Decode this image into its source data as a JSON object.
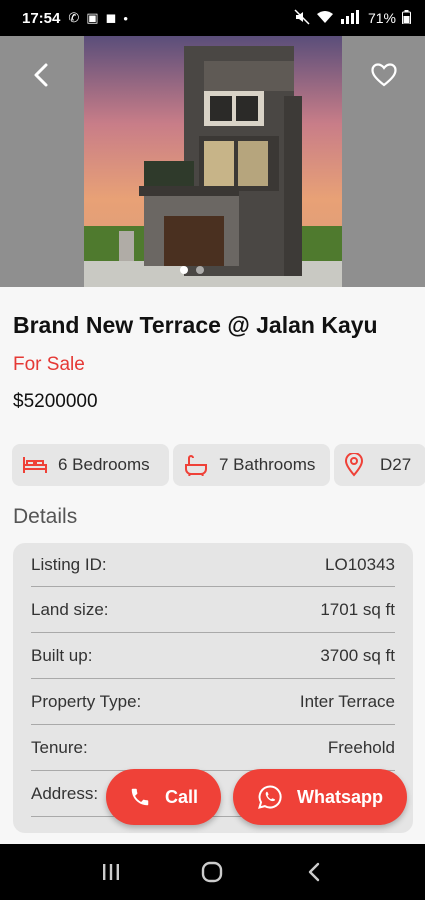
{
  "status_bar": {
    "time": "17:54",
    "battery": "71%"
  },
  "listing": {
    "title": "Brand New Terrace @ Jalan Kayu",
    "status": "For Sale",
    "price": "$5200000"
  },
  "features": {
    "bedrooms": "6 Bedrooms",
    "bathrooms": "7 Bathrooms",
    "district": "D27"
  },
  "details": {
    "heading": "Details",
    "rows": [
      {
        "label": "Listing ID:",
        "value": "LO10343"
      },
      {
        "label": "Land size:",
        "value": "1701 sq ft"
      },
      {
        "label": "Built up:",
        "value": "3700 sq ft"
      },
      {
        "label": "Property Type:",
        "value": "Inter Terrace"
      },
      {
        "label": "Tenure:",
        "value": "Freehold"
      },
      {
        "label": "Address:",
        "value": ""
      }
    ]
  },
  "actions": {
    "call_label": "Call",
    "whatsapp_label": "Whatsapp"
  },
  "carousel": {
    "total": 2,
    "active": 1
  },
  "colors": {
    "accent": "#ef4138",
    "sale_text": "#e53935"
  },
  "icons": [
    "back-icon",
    "heart-icon",
    "bed-icon",
    "bathtub-icon",
    "location-pin-icon",
    "phone-icon",
    "whatsapp-icon",
    "recents-icon",
    "home-icon",
    "back-nav-icon"
  ]
}
